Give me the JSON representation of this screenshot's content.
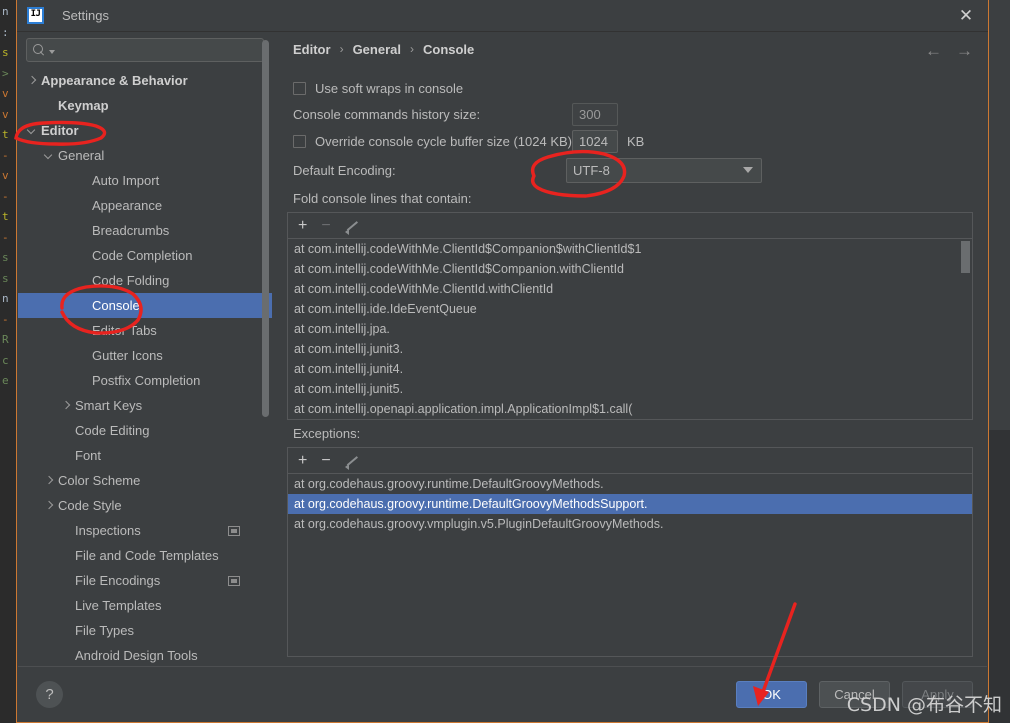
{
  "window": {
    "title": "Settings",
    "logo_text": "IJ",
    "close_label": "✕"
  },
  "search": {
    "value": "",
    "placeholder": ""
  },
  "sidebar": {
    "items": [
      {
        "label": "Appearance & Behavior",
        "indent": 0,
        "arrow": "right",
        "bold": true,
        "selected": false,
        "badge": false
      },
      {
        "label": "Keymap",
        "indent": 1,
        "arrow": "none",
        "bold": true,
        "selected": false,
        "badge": false
      },
      {
        "label": "Editor",
        "indent": 0,
        "arrow": "down",
        "bold": true,
        "selected": false,
        "badge": false
      },
      {
        "label": "General",
        "indent": 1,
        "arrow": "down",
        "bold": false,
        "selected": false,
        "badge": false
      },
      {
        "label": "Auto Import",
        "indent": 3,
        "arrow": "none",
        "bold": false,
        "selected": false,
        "badge": false
      },
      {
        "label": "Appearance",
        "indent": 3,
        "arrow": "none",
        "bold": false,
        "selected": false,
        "badge": false
      },
      {
        "label": "Breadcrumbs",
        "indent": 3,
        "arrow": "none",
        "bold": false,
        "selected": false,
        "badge": false
      },
      {
        "label": "Code Completion",
        "indent": 3,
        "arrow": "none",
        "bold": false,
        "selected": false,
        "badge": false
      },
      {
        "label": "Code Folding",
        "indent": 3,
        "arrow": "none",
        "bold": false,
        "selected": false,
        "badge": false
      },
      {
        "label": "Console",
        "indent": 3,
        "arrow": "none",
        "bold": false,
        "selected": true,
        "badge": false
      },
      {
        "label": "Editor Tabs",
        "indent": 3,
        "arrow": "none",
        "bold": false,
        "selected": false,
        "badge": false
      },
      {
        "label": "Gutter Icons",
        "indent": 3,
        "arrow": "none",
        "bold": false,
        "selected": false,
        "badge": false
      },
      {
        "label": "Postfix Completion",
        "indent": 3,
        "arrow": "none",
        "bold": false,
        "selected": false,
        "badge": false
      },
      {
        "label": "Smart Keys",
        "indent": 2,
        "arrow": "right",
        "bold": false,
        "selected": false,
        "badge": false
      },
      {
        "label": "Code Editing",
        "indent": 2,
        "arrow": "none",
        "bold": false,
        "selected": false,
        "badge": false
      },
      {
        "label": "Font",
        "indent": 2,
        "arrow": "none",
        "bold": false,
        "selected": false,
        "badge": false
      },
      {
        "label": "Color Scheme",
        "indent": 1,
        "arrow": "right",
        "bold": false,
        "selected": false,
        "badge": false
      },
      {
        "label": "Code Style",
        "indent": 1,
        "arrow": "right",
        "bold": false,
        "selected": false,
        "badge": false
      },
      {
        "label": "Inspections",
        "indent": 2,
        "arrow": "none",
        "bold": false,
        "selected": false,
        "badge": true
      },
      {
        "label": "File and Code Templates",
        "indent": 2,
        "arrow": "none",
        "bold": false,
        "selected": false,
        "badge": false
      },
      {
        "label": "File Encodings",
        "indent": 2,
        "arrow": "none",
        "bold": false,
        "selected": false,
        "badge": true
      },
      {
        "label": "Live Templates",
        "indent": 2,
        "arrow": "none",
        "bold": false,
        "selected": false,
        "badge": false
      },
      {
        "label": "File Types",
        "indent": 2,
        "arrow": "none",
        "bold": false,
        "selected": false,
        "badge": false
      },
      {
        "label": "Android Design Tools",
        "indent": 2,
        "arrow": "none",
        "bold": false,
        "selected": false,
        "badge": false
      }
    ]
  },
  "content": {
    "breadcrumb": {
      "part1": "Editor",
      "part2": "General",
      "part3": "Console",
      "separator": "›"
    },
    "nav": {
      "back": "←",
      "forward": "→"
    },
    "soft_wraps": {
      "label": "Use soft wraps in console",
      "checked": false
    },
    "history_size": {
      "label": "Console commands history size:",
      "value": "300"
    },
    "cycle_buffer": {
      "label": "Override console cycle buffer size (1024 KB)",
      "value": "1024",
      "unit": "KB",
      "checked": false
    },
    "encoding": {
      "label": "Default Encoding:",
      "value": "UTF-8"
    },
    "fold": {
      "label": "Fold console lines that contain:",
      "toolbar": {
        "add": "+",
        "remove": "−",
        "edit": "edit-pencil"
      },
      "items": [
        "at com.intellij.codeWithMe.ClientId$Companion$withClientId$1",
        "at com.intellij.codeWithMe.ClientId$Companion.withClientId",
        "at com.intellij.codeWithMe.ClientId.withClientId",
        "at com.intellij.ide.IdeEventQueue",
        "at com.intellij.jpa.",
        "at com.intellij.junit3.",
        "at com.intellij.junit4.",
        "at com.intellij.junit5.",
        "at com.intellij.openapi.application.impl.ApplicationImpl$1.call("
      ]
    },
    "exceptions": {
      "label": "Exceptions:",
      "toolbar": {
        "add": "+",
        "remove": "−",
        "edit": "edit-pencil"
      },
      "items": [
        {
          "text": "at org.codehaus.groovy.runtime.DefaultGroovyMethods.",
          "selected": false
        },
        {
          "text": "at org.codehaus.groovy.runtime.DefaultGroovyMethodsSupport.",
          "selected": true
        },
        {
          "text": "at org.codehaus.groovy.vmplugin.v5.PluginDefaultGroovyMethods.",
          "selected": false
        }
      ]
    }
  },
  "footer": {
    "help": "?",
    "ok": "OK",
    "cancel": "Cancel",
    "apply": "Apply"
  },
  "watermark": {
    "text": "CSDN @布谷不知"
  },
  "colors": {
    "accent": "#4b6eaf",
    "dialog_bg": "#3c3f41",
    "text": "#bbbbbb",
    "annotation_red": "#e8231f",
    "border": "#cc7832"
  },
  "background_editor": {
    "lines": [
      "n",
      ":",
      "s",
      ">",
      "v",
      "v",
      "t",
      "-",
      "v",
      "-",
      "t",
      "-",
      "s",
      "s",
      "n",
      "-",
      "R",
      "c",
      "e"
    ]
  }
}
